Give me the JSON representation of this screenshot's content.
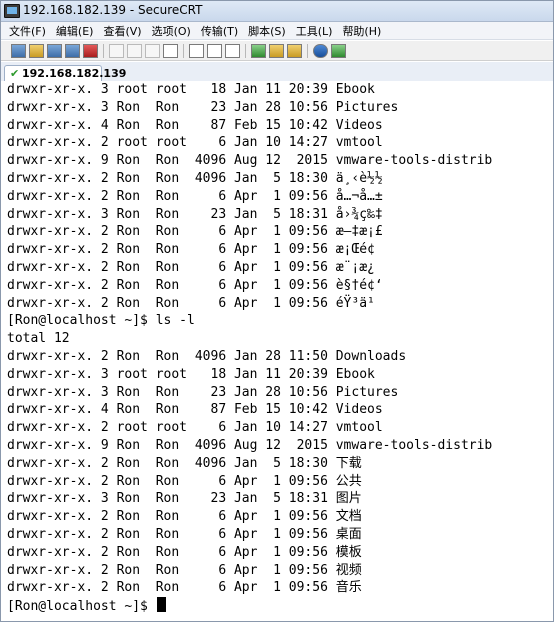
{
  "window": {
    "title": "192.168.182.139 - SecureCRT"
  },
  "menu": [
    "文件(F)",
    "编辑(E)",
    "查看(V)",
    "选项(O)",
    "传输(T)",
    "脚本(S)",
    "工具(L)",
    "帮助(H)"
  ],
  "toolbar": {
    "icons": [
      "connect-icon",
      "quick-connect-icon",
      "connect-in-tab-icon",
      "reconnect-icon",
      "disconnect-icon",
      "copy-icon",
      "paste-icon",
      "copy-paste-icon",
      "find-icon",
      "print-icon",
      "print-selection-icon",
      "printer-setup-icon",
      "session-options-icon",
      "global-options-icon",
      "key-icon",
      "help-icon",
      "keymap-icon"
    ]
  },
  "tab": {
    "label": "192.168.182.139",
    "status_icon": "check-icon"
  },
  "terminal": {
    "lines": [
      "drwxr-xr-x. 3 root root   18 Jan 11 20:39 Ebook",
      "drwxr-xr-x. 3 Ron  Ron    23 Jan 28 10:56 Pictures",
      "drwxr-xr-x. 4 Ron  Ron    87 Feb 15 10:42 Videos",
      "drwxr-xr-x. 2 root root    6 Jan 10 14:27 vmtool",
      "drwxr-xr-x. 9 Ron  Ron  4096 Aug 12  2015 vmware-tools-distrib",
      "drwxr-xr-x. 2 Ron  Ron  4096 Jan  5 18:30 ä¸‹è½½",
      "drwxr-xr-x. 2 Ron  Ron     6 Apr  1 09:56 å…¬å…±",
      "drwxr-xr-x. 3 Ron  Ron    23 Jan  5 18:31 å›¾ç‰‡",
      "drwxr-xr-x. 2 Ron  Ron     6 Apr  1 09:56 æ–‡æ¡£",
      "drwxr-xr-x. 2 Ron  Ron     6 Apr  1 09:56 æ¡Œé¢",
      "drwxr-xr-x. 2 Ron  Ron     6 Apr  1 09:56 æ¨¡æ¿",
      "drwxr-xr-x. 2 Ron  Ron     6 Apr  1 09:56 è§†é¢‘",
      "drwxr-xr-x. 2 Ron  Ron     6 Apr  1 09:56 éŸ³ä¹",
      "[Ron@localhost ~]$ ls -l",
      "total 12",
      "drwxr-xr-x. 2 Ron  Ron  4096 Jan 28 11:50 Downloads",
      "drwxr-xr-x. 3 root root   18 Jan 11 20:39 Ebook",
      "drwxr-xr-x. 3 Ron  Ron    23 Jan 28 10:56 Pictures",
      "drwxr-xr-x. 4 Ron  Ron    87 Feb 15 10:42 Videos",
      "drwxr-xr-x. 2 root root    6 Jan 10 14:27 vmtool",
      "drwxr-xr-x. 9 Ron  Ron  4096 Aug 12  2015 vmware-tools-distrib",
      "drwxr-xr-x. 2 Ron  Ron  4096 Jan  5 18:30 下载",
      "drwxr-xr-x. 2 Ron  Ron     6 Apr  1 09:56 公共",
      "drwxr-xr-x. 3 Ron  Ron    23 Jan  5 18:31 图片",
      "drwxr-xr-x. 2 Ron  Ron     6 Apr  1 09:56 文档",
      "drwxr-xr-x. 2 Ron  Ron     6 Apr  1 09:56 桌面",
      "drwxr-xr-x. 2 Ron  Ron     6 Apr  1 09:56 模板",
      "drwxr-xr-x. 2 Ron  Ron     6 Apr  1 09:56 视频",
      "drwxr-xr-x. 2 Ron  Ron     6 Apr  1 09:56 音乐"
    ],
    "prompt": "[Ron@localhost ~]$ "
  }
}
